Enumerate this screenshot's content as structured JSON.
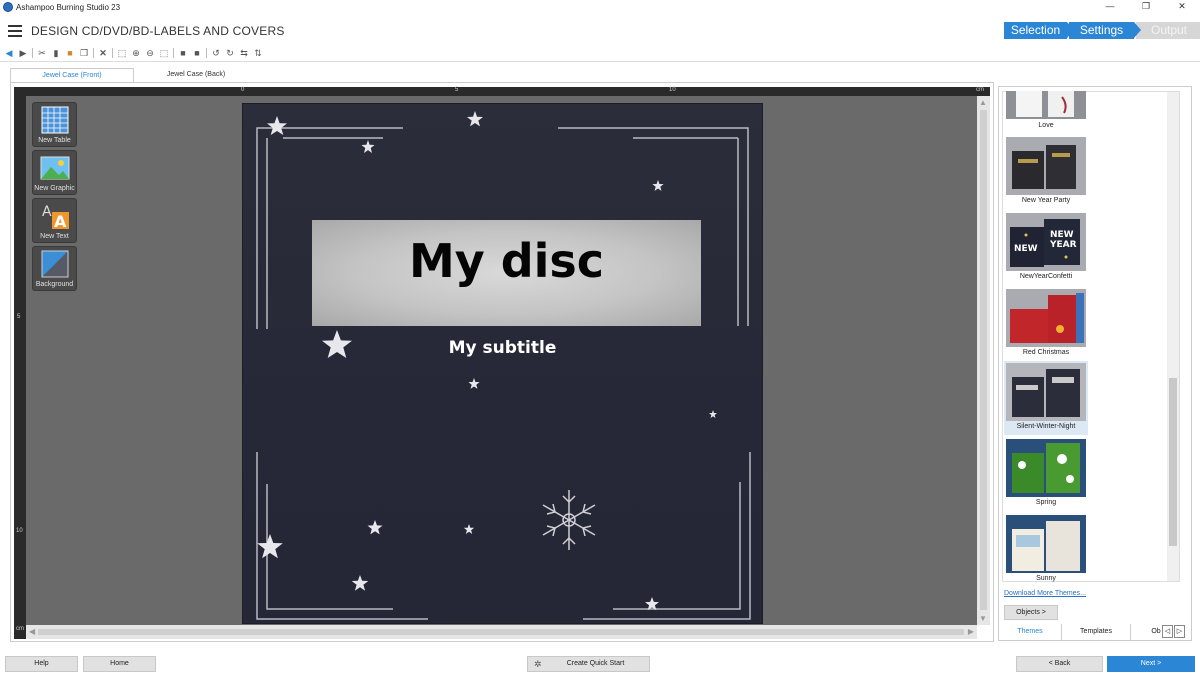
{
  "window": {
    "title": "Ashampoo Burning Studio 23",
    "controls": [
      "—",
      "❐",
      "✕"
    ]
  },
  "header": {
    "title": "DESIGN CD/DVD/BD-LABELS AND COVERS",
    "steps": [
      {
        "label": "Selection",
        "state": "done"
      },
      {
        "label": "Settings",
        "state": "active"
      },
      {
        "label": "Output",
        "state": "inactive"
      }
    ]
  },
  "toolbar": {
    "icons": [
      "back-icon",
      "forward-icon",
      "cut-icon",
      "delete-icon",
      "paste-icon",
      "copy-icon",
      "remove-icon",
      "zoom-fit-icon",
      "zoom-in-icon",
      "zoom-out-icon",
      "zoom-page-icon",
      "bring-front-icon",
      "send-back-icon",
      "rotate-left-icon",
      "rotate-right-icon",
      "flip-horizontal-icon",
      "flip-vertical-icon"
    ]
  },
  "doc_tabs": [
    {
      "label": "Jewel Case (Front)",
      "active": true
    },
    {
      "label": "Jewel Case (Back)",
      "active": false
    }
  ],
  "rulers": {
    "unit": "cm",
    "top_labels": [
      "0",
      "5",
      "10"
    ],
    "left_labels": [
      "5",
      "10"
    ]
  },
  "tools": [
    {
      "label": "New Table",
      "icon": "table-icon"
    },
    {
      "label": "New Graphic",
      "icon": "graphic-icon"
    },
    {
      "label": "New Text",
      "icon": "text-icon"
    },
    {
      "label": "Background",
      "icon": "background-icon"
    }
  ],
  "cover": {
    "title": "My disc",
    "subtitle": "My subtitle",
    "background_color": "#2a2c3a",
    "title_box_color": "#c9c9c9"
  },
  "themes": [
    {
      "label": "Love",
      "colors": [
        "#f3f3f3",
        "#a12c3a"
      ]
    },
    {
      "label": "New Year Party",
      "colors": [
        "#2a2a2e",
        "#b79b4a"
      ]
    },
    {
      "label": "NewYearConfetti",
      "colors": [
        "#1f2333",
        "#e0c35a"
      ]
    },
    {
      "label": "Red Christmas",
      "colors": [
        "#c0262a",
        "#3b73b8"
      ]
    },
    {
      "label": "Silent-Winter-Night",
      "colors": [
        "#2b2d3a",
        "#c9c9c9"
      ],
      "selected": true
    },
    {
      "label": "Spring",
      "colors": [
        "#3a8a2a",
        "#ffffff"
      ]
    },
    {
      "label": "Sunny",
      "colors": [
        "#f2ede1",
        "#a8c8e0"
      ]
    }
  ],
  "panel": {
    "download_link": "Download More Themes...",
    "objects_button": "Objects >",
    "tabs": [
      "Themes",
      "Templates",
      "Ob"
    ],
    "nav_arrows": [
      "◁",
      "▷"
    ]
  },
  "bottom": {
    "help": "Help",
    "home": "Home",
    "quick_start": "Create Quick Start",
    "back": "< Back",
    "next": "Next >"
  },
  "colors": {
    "accent": "#2b86d6",
    "canvas_bg": "#6a6a6a"
  }
}
